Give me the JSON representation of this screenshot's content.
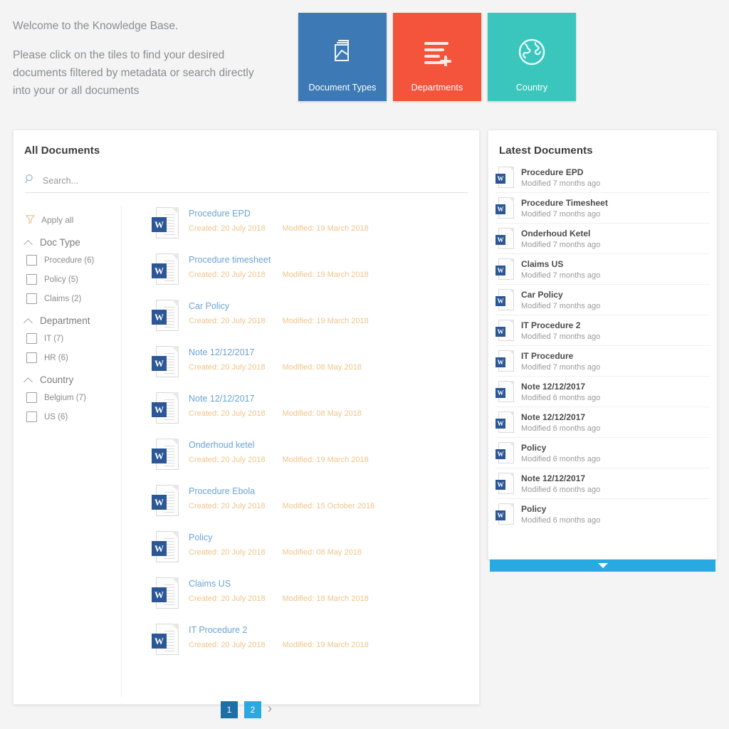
{
  "welcome": {
    "line1": "Welcome to the Knowledge Base.",
    "line2": "Please click on the tiles to find your desired documents filtered by metadata or search directly into your or all documents"
  },
  "tiles": [
    {
      "label": "Document Types",
      "icon": "documents-icon",
      "color": "#3d7ab5"
    },
    {
      "label": "Departments",
      "icon": "list-add-icon",
      "color": "#f4533c"
    },
    {
      "label": "Country",
      "icon": "globe-icon",
      "color": "#3ac6bd"
    }
  ],
  "all_documents": {
    "title": "All Documents",
    "search": {
      "placeholder": "Search...",
      "value": "",
      "icon": "search-icon"
    },
    "apply_all": {
      "label": "Apply all",
      "icon": "filter-icon"
    },
    "facets": [
      {
        "name": "Doc Type",
        "options": [
          {
            "label": "Procedure (6)",
            "checked": false
          },
          {
            "label": "Policy (5)",
            "checked": false
          },
          {
            "label": "Claims (2)",
            "checked": false
          }
        ]
      },
      {
        "name": "Department",
        "options": [
          {
            "label": "IT (7)",
            "checked": false
          },
          {
            "label": "HR (6)",
            "checked": false
          }
        ]
      },
      {
        "name": "Country",
        "options": [
          {
            "label": "Belgium (7)",
            "checked": false
          },
          {
            "label": "US (6)",
            "checked": false
          }
        ]
      }
    ],
    "documents": [
      {
        "title": "Procedure EPD",
        "created": "Created: 20 July 2018",
        "modified": "Modified: 19 March 2018"
      },
      {
        "title": "Procedure timesheet",
        "created": "Created: 20 July 2018",
        "modified": "Modified: 19 March 2018"
      },
      {
        "title": "Car Policy",
        "created": "Created: 20 July 2018",
        "modified": "Modified: 19 March 2018"
      },
      {
        "title": "Note 12/12/2017",
        "created": "Created: 20 July 2018",
        "modified": "Modified: 08 May 2018"
      },
      {
        "title": "Note 12/12/2017",
        "created": "Created: 20 July 2018",
        "modified": "Modified: 08 May 2018"
      },
      {
        "title": "Onderhoud ketel",
        "created": "Created: 20 July 2018",
        "modified": "Modified: 19 March 2018"
      },
      {
        "title": "Procedure Ebola",
        "created": "Created: 20 July 2018",
        "modified": "Modified: 15 October 2018"
      },
      {
        "title": "Policy",
        "created": "Created: 20 July 2018",
        "modified": "Modified: 08 May 2018"
      },
      {
        "title": "Claims US",
        "created": "Created: 20 July 2018",
        "modified": "Modified: 18 March 2018"
      },
      {
        "title": "IT Procedure 2",
        "created": "Created: 20 July 2018",
        "modified": "Modified: 19 March 2018"
      }
    ],
    "pagination": {
      "pages": [
        "1",
        "2"
      ],
      "current": "1",
      "next_icon": "chevron-right-icon"
    }
  },
  "latest_documents": {
    "title": "Latest Documents",
    "items": [
      {
        "title": "Procedure EPD",
        "modified": "Modified 7 months ago"
      },
      {
        "title": "Procedure Timesheet",
        "modified": "Modified 7 months ago"
      },
      {
        "title": "Onderhoud Ketel",
        "modified": "Modified 7 months ago"
      },
      {
        "title": "Claims US",
        "modified": "Modified 7 months ago"
      },
      {
        "title": "Car Policy",
        "modified": "Modified 7 months ago"
      },
      {
        "title": "IT Procedure 2",
        "modified": "Modified 7 months ago"
      },
      {
        "title": "IT Procedure",
        "modified": "Modified 7 months ago"
      },
      {
        "title": "Note 12/12/2017",
        "modified": "Modified 6 months ago"
      },
      {
        "title": "Note 12/12/2017",
        "modified": "Modified 6 months ago"
      },
      {
        "title": "Policy",
        "modified": "Modified 6 months ago"
      },
      {
        "title": "Note 12/12/2017",
        "modified": "Modified 6 months ago"
      },
      {
        "title": "Policy",
        "modified": "Modified 6 months ago"
      }
    ],
    "load_more": {
      "icon": "caret-down-icon",
      "color": "#29a9e1"
    }
  },
  "word_icon_letter": "W",
  "colors": {
    "background": "#f4f4f4",
    "panel": "#ffffff",
    "link": "#6ba3d6",
    "date": "#f0c48a"
  }
}
